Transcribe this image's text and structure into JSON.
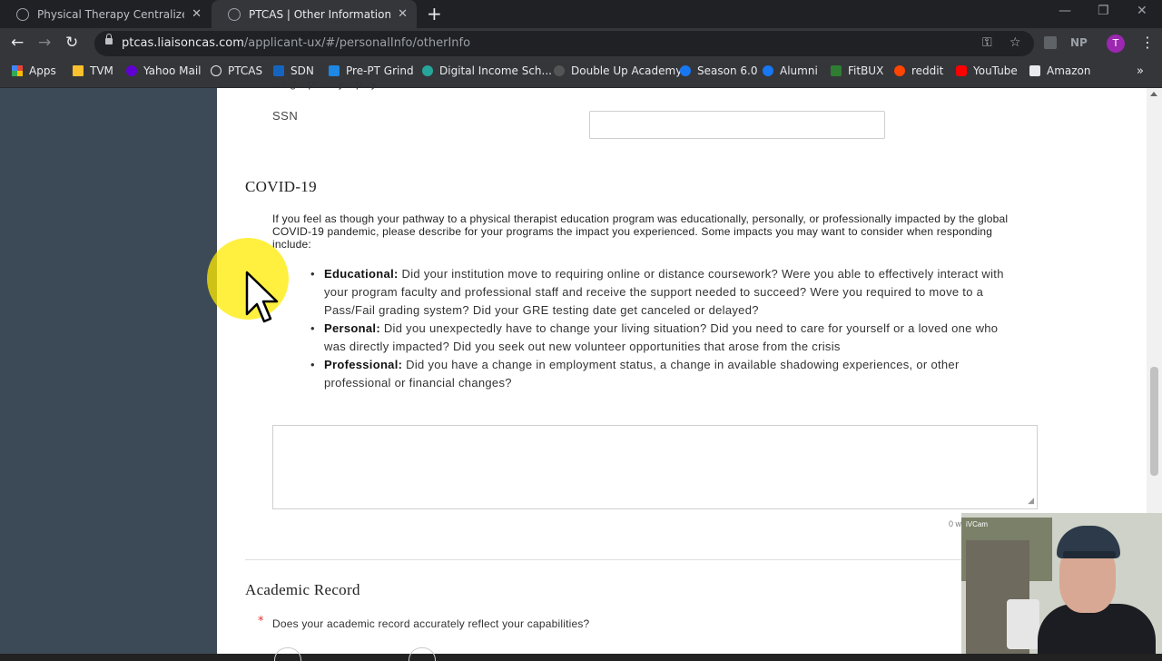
{
  "browser": {
    "tabs": [
      {
        "title": "Physical Therapy Centralized App",
        "active": false
      },
      {
        "title": "PTCAS | Other Information Sectio",
        "active": true
      }
    ],
    "url_host": "ptcas.liaisoncas.com",
    "url_path": "/applicant-ux/#/personalInfo/otherInfo",
    "ext_label": "NP",
    "profile_initial": "T",
    "bookmarks": [
      {
        "label": "Apps",
        "color": "#ea4335"
      },
      {
        "label": "TVM",
        "color": "#fbc02d"
      },
      {
        "label": "Yahoo Mail",
        "color": "#6001d2"
      },
      {
        "label": "PTCAS",
        "color": "#e8eaed"
      },
      {
        "label": "SDN",
        "color": "#1565c0"
      },
      {
        "label": "Pre-PT Grind",
        "color": "#1e88e5"
      },
      {
        "label": "Digital Income Sch...",
        "color": "#26a69a"
      },
      {
        "label": "Double Up Academy",
        "color": "#555555"
      },
      {
        "label": "Season 6.0",
        "color": "#1877f2"
      },
      {
        "label": "Alumni",
        "color": "#1877f2"
      },
      {
        "label": "FitBUX",
        "color": "#2e7d32"
      },
      {
        "label": "reddit",
        "color": "#ff4500"
      },
      {
        "label": "YouTube",
        "color": "#ff0000"
      },
      {
        "label": "Amazon",
        "color": "#e8eaed"
      }
    ]
  },
  "page": {
    "cutoff_text": "...ing... pr... ...y ...p...y",
    "ssn_label": "SSN",
    "covid_title": "COVID-19",
    "covid_intro": "If you feel as though your pathway to a physical therapist education program was educationally, personally, or professionally impacted by the global COVID-19 pandemic, please describe for your programs the impact you experienced. Some impacts you may want to consider when responding include:",
    "bullets": [
      {
        "term": "Educational:",
        "text": " Did your institution move to requiring online or distance coursework? Were you able to effectively interact with your program faculty and professional staff and receive the support needed to succeed? Were you required to move to a Pass/Fail grading system? Did your GRE testing date get canceled or delayed?"
      },
      {
        "term": "Personal:",
        "text": " Did you unexpectedly have to change your living situation? Did you need to care for yourself or a loved one who was directly impacted? Did you seek out new volunteer opportunities that arose from the crisis"
      },
      {
        "term": "Professional:",
        "text": " Did you have a change in employment status, a change in available shadowing experiences, or other professional or financial changes?"
      }
    ],
    "textarea_value": "",
    "word_count": "0 w",
    "academic_title": "Academic Record",
    "required_mark": "*",
    "academic_question": "Does your academic record accurately reflect your capabilities?"
  },
  "webcam": {
    "tag": "iVCam"
  }
}
